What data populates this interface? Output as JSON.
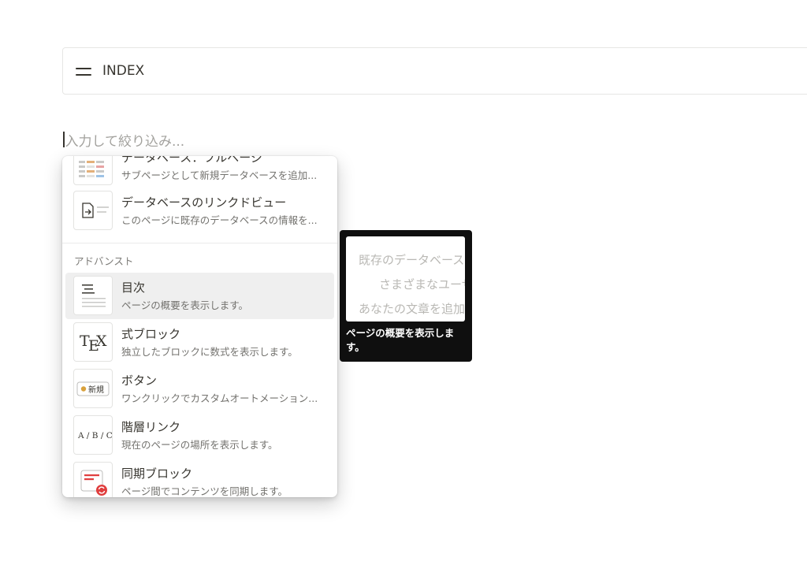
{
  "callout": {
    "title": "INDEX"
  },
  "filter": {
    "placeholder": "入力して絞り込み..."
  },
  "menu": {
    "partial_item": {
      "title": "データベース：フルページ",
      "description": "サブページとして新規データベースを追加..."
    },
    "linked_view": {
      "title": "データベースのリンクドビュー",
      "description": "このページに既存のデータベースの情報を..."
    },
    "section_label": "アドバンスト",
    "advanced_items": [
      {
        "title": "目次",
        "description": "ページの概要を表示します。",
        "icon": "table-of-contents-icon"
      },
      {
        "title": "式ブロック",
        "description": "独立したブロックに数式を表示します。",
        "icon": "tex-icon"
      },
      {
        "title": "ボタン",
        "description": "ワンクリックでカスタムオートメーション...",
        "icon": "button-icon"
      },
      {
        "title": "階層リンク",
        "description": "現在のページの場所を表示します。",
        "icon": "breadcrumb-icon"
      },
      {
        "title": "同期ブロック",
        "description": "ページ間でコンテンツを同期します。",
        "icon": "synced-block-icon"
      }
    ]
  },
  "icons": {
    "tex": {
      "t": "T",
      "e": "E",
      "x": "X"
    },
    "button": {
      "label": "新規"
    },
    "breadcrumb": {
      "label": "A / B / C"
    }
  },
  "preview": {
    "lines": [
      "既存のデータベース",
      "さまざまなユーザー",
      "あなたの文章を追加"
    ],
    "caption": "ページの概要を表示します。"
  },
  "colors": {
    "selected_bg": "#efefef",
    "preview_bg": "#0f0f0f",
    "accent_red": "#e03e3e",
    "button_dot": "#d9a13b"
  }
}
